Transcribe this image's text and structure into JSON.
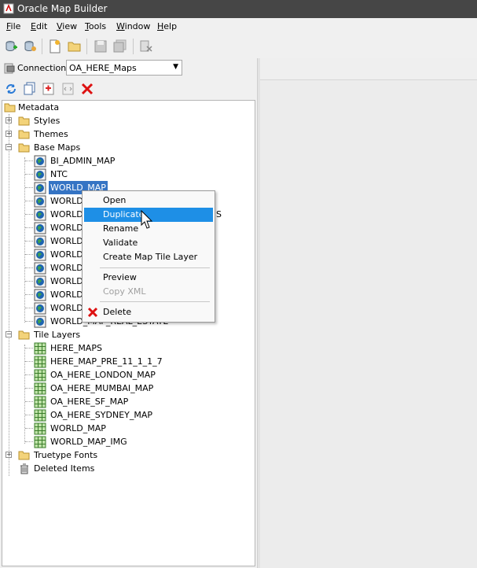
{
  "window": {
    "title": "Oracle Map Builder"
  },
  "menubar": {
    "items": [
      {
        "label": "File",
        "mnemonic": "F",
        "rest": "ile"
      },
      {
        "label": "Edit",
        "mnemonic": "E",
        "rest": "dit"
      },
      {
        "label": "View",
        "mnemonic": "V",
        "rest": "iew"
      },
      {
        "label": "Tools",
        "mnemonic": "T",
        "rest": "ools"
      },
      {
        "label": "Window",
        "mnemonic": "W",
        "rest": "indow"
      },
      {
        "label": "Help",
        "mnemonic": "H",
        "rest": "elp"
      }
    ]
  },
  "connection": {
    "label": "Connection:",
    "value": "OA_HERE_Maps"
  },
  "tree": {
    "root": "Metadata",
    "styles": "Styles",
    "themes": "Themes",
    "base_maps": "Base Maps",
    "base_map_items": [
      "BI_ADMIN_MAP",
      "NTC",
      "WORLD_MAP",
      "WORLD_",
      "WORLD_",
      "WORLD_",
      "WORLD_",
      "WORLD_",
      "WORLD_",
      "WORLD_",
      "WORLD_",
      "WORLD_",
      "WORLD_MAP_REAL_ESTATE"
    ],
    "base_map_partial_suffix": "S",
    "tile_layers": "Tile Layers",
    "tile_layer_items": [
      "HERE_MAPS",
      "HERE_MAP_PRE_11_1_1_7",
      "OA_HERE_LONDON_MAP",
      "OA_HERE_MUMBAI_MAP",
      "OA_HERE_SF_MAP",
      "OA_HERE_SYDNEY_MAP",
      "WORLD_MAP",
      "WORLD_MAP_IMG"
    ],
    "truetype_fonts": "Truetype Fonts",
    "deleted_items": "Deleted Items"
  },
  "context_menu": {
    "open": "Open",
    "duplicate": "Duplicate",
    "rename": "Rename",
    "validate": "Validate",
    "create_tile_layer": "Create Map Tile Layer",
    "preview": "Preview",
    "copy_xml": "Copy XML",
    "delete": "Delete"
  },
  "colors": {
    "selection": "#3574c4",
    "menu_highlight": "#1e8fe6",
    "titlebar": "#464646"
  }
}
